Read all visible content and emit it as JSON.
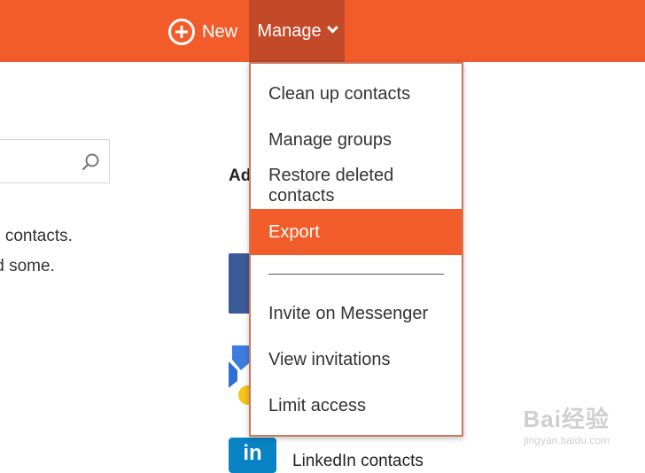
{
  "toolbar": {
    "new_label": "New",
    "manage_label": "Manage"
  },
  "left": {
    "line1": "o contacts.",
    "line2": "ld some."
  },
  "right": {
    "heading": "Ad",
    "linkedin_icon": "in",
    "linkedin_label": "LinkedIn contacts"
  },
  "menu": {
    "items": [
      {
        "label": "Clean up contacts"
      },
      {
        "label": "Manage groups"
      },
      {
        "label": "Restore deleted contacts"
      },
      {
        "label": "Export",
        "selected": true
      },
      {
        "label": "Invite on Messenger"
      },
      {
        "label": "View invitations"
      },
      {
        "label": "Limit access"
      }
    ]
  },
  "watermark": {
    "main": "Bai经验",
    "sub": "jingyan.baidu.com"
  },
  "colors": {
    "accent": "#f25c2a",
    "manage_active": "#c24a28",
    "facebook": "#3b5a9a",
    "linkedin": "#0a83c4"
  },
  "icons": {
    "new": "plus-circle-icon",
    "manage": "chevron-down-icon",
    "search": "search-icon"
  }
}
